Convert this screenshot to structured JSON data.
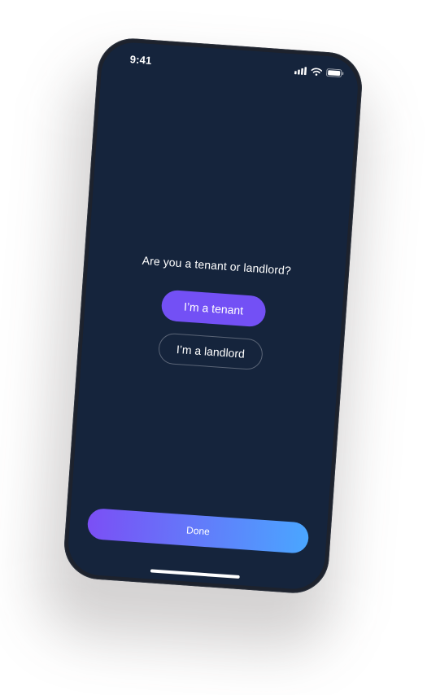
{
  "status_bar": {
    "time": "9:41",
    "icons": [
      "signal-icon",
      "wifi-icon",
      "battery-icon"
    ]
  },
  "onboarding": {
    "question": "Are you a tenant or landlord?",
    "options": [
      {
        "label": "I’m a tenant",
        "selected": true
      },
      {
        "label": "I’m a landlord",
        "selected": false
      }
    ],
    "done_label": "Done"
  },
  "colors": {
    "screen_bg": "#15243c",
    "accent": "#7350f5",
    "done_gradient_start": "#7b4ff5",
    "done_gradient_end": "#4aa6ff"
  }
}
